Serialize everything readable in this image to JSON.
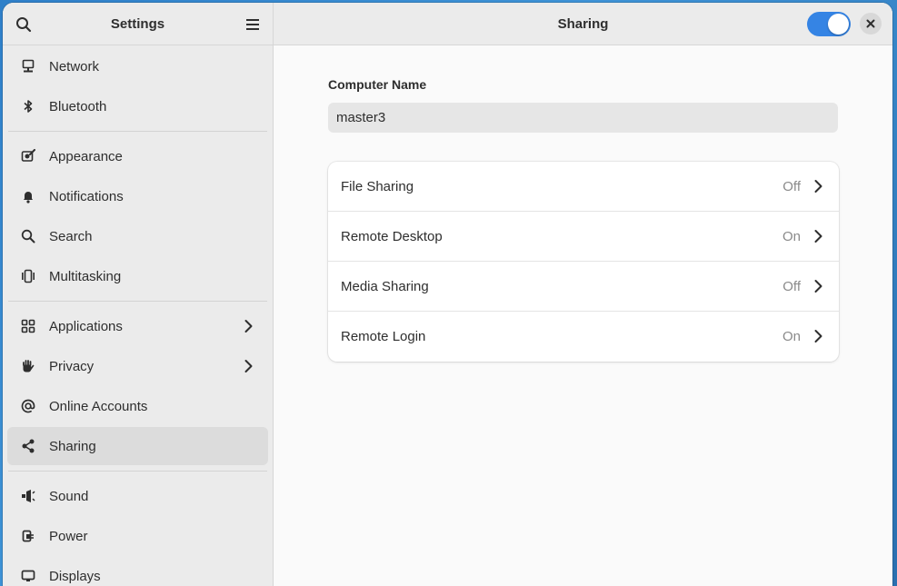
{
  "sidebar": {
    "title": "Settings",
    "groups": [
      [
        {
          "label": "Network",
          "icon": "network-icon"
        },
        {
          "label": "Bluetooth",
          "icon": "bluetooth-icon"
        }
      ],
      [
        {
          "label": "Appearance",
          "icon": "appearance-icon"
        },
        {
          "label": "Notifications",
          "icon": "bell-icon"
        },
        {
          "label": "Search",
          "icon": "search-icon"
        },
        {
          "label": "Multitasking",
          "icon": "multitasking-icon"
        }
      ],
      [
        {
          "label": "Applications",
          "icon": "grid-icon",
          "chevron": true
        },
        {
          "label": "Privacy",
          "icon": "hand-icon",
          "chevron": true
        },
        {
          "label": "Online Accounts",
          "icon": "at-icon"
        },
        {
          "label": "Sharing",
          "icon": "share-icon",
          "active": true
        }
      ],
      [
        {
          "label": "Sound",
          "icon": "speaker-icon"
        },
        {
          "label": "Power",
          "icon": "power-plug-icon"
        },
        {
          "label": "Displays",
          "icon": "display-icon"
        }
      ]
    ]
  },
  "header": {
    "title": "Sharing",
    "toggle_on": true
  },
  "computer_name": {
    "label": "Computer Name",
    "value": "master3"
  },
  "services": [
    {
      "label": "File Sharing",
      "status": "Off"
    },
    {
      "label": "Remote Desktop",
      "status": "On"
    },
    {
      "label": "Media Sharing",
      "status": "Off"
    },
    {
      "label": "Remote Login",
      "status": "On"
    }
  ],
  "colors": {
    "accent": "#3584e4"
  }
}
